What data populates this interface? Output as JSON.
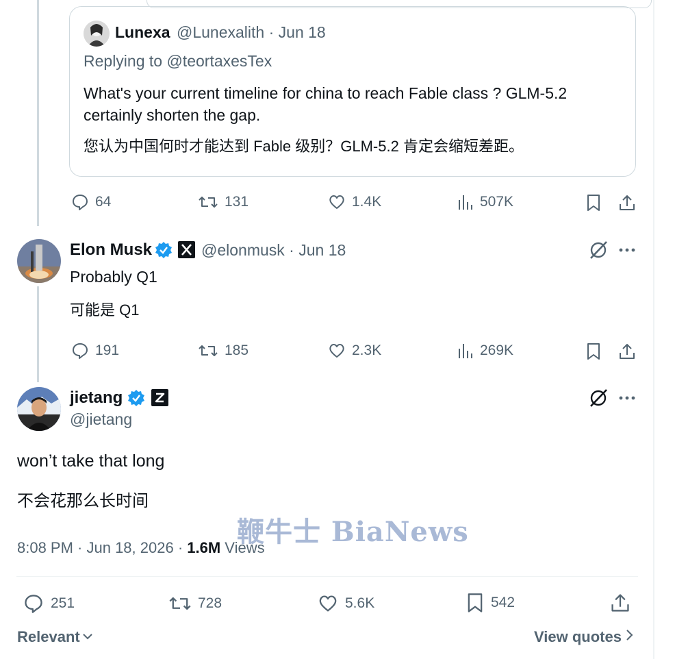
{
  "quoted": {
    "name": "Lunexa",
    "handle_date": "@Lunexalith · Jun 18",
    "replying": "Replying to @teortaxesTex",
    "text_en": "What's your current timeline for china to reach Fable class ? GLM-5.2 certainly shorten the gap.",
    "text_zh": "您认为中国何时才能达到 Fable 级别？GLM-5.2 肯定会缩短差距。"
  },
  "quoted_stats": {
    "replies": "64",
    "reposts": "131",
    "likes": "1.4K",
    "views": "507K"
  },
  "elon": {
    "name": "Elon Musk",
    "handle_date": "@elonmusk · Jun 18",
    "text_en": "Probably Q1",
    "text_zh": "可能是 Q1",
    "stats": {
      "replies": "191",
      "reposts": "185",
      "likes": "2.3K",
      "views": "269K"
    }
  },
  "main": {
    "name": "jietang",
    "handle": "@jietang",
    "text_en": "won’t take that long",
    "text_zh": "不会花那么长时间",
    "time": "8:08 PM · Jun 18, 2026 · ",
    "views_count": "1.6M",
    "views_label": " Views",
    "stats": {
      "replies": "251",
      "reposts": "728",
      "likes": "5.6K",
      "bookmarks": "542"
    }
  },
  "footer": {
    "sort": "Relevant",
    "view_quotes": "View quotes"
  },
  "watermark": "鞭牛士 BiaNews",
  "colors": {
    "verified": "#1d9bf0",
    "muted": "#536471",
    "border": "#cfd9de"
  }
}
